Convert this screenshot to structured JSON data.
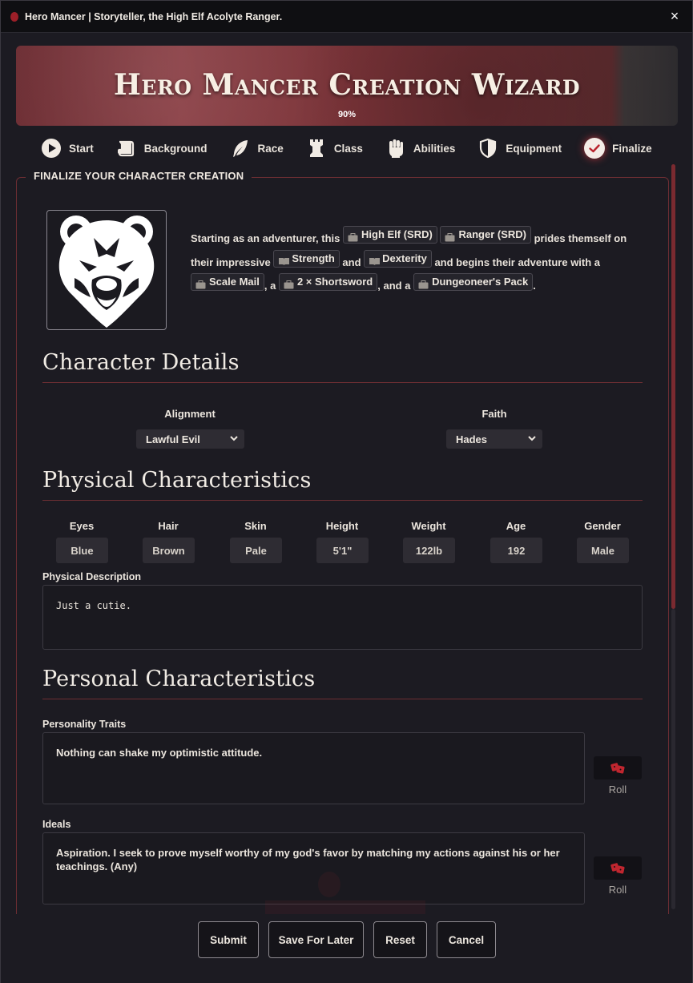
{
  "window": {
    "title": "Hero Mancer | Storyteller, the High Elf Acolyte Ranger.",
    "close_icon": "×"
  },
  "banner": {
    "title": "Hero Mancer Creation Wizard",
    "progress_label": "90%",
    "progress": 0.9
  },
  "steps": [
    {
      "label": "Start",
      "icon": "play-icon"
    },
    {
      "label": "Background",
      "icon": "scroll-icon"
    },
    {
      "label": "Race",
      "icon": "feather-icon"
    },
    {
      "label": "Class",
      "icon": "chess-rook-icon"
    },
    {
      "label": "Abilities",
      "icon": "fist-icon"
    },
    {
      "label": "Equipment",
      "icon": "shield-icon"
    },
    {
      "label": "Finalize",
      "icon": "check-icon",
      "active": true
    }
  ],
  "panel": {
    "legend": "FINALIZE YOUR CHARACTER CREATION"
  },
  "summary": {
    "t1": "Starting as an adventurer, this",
    "race": "High Elf (SRD)",
    "class": "Ranger (SRD)",
    "t2": "prides themself on their impressive",
    "ability1": "Strength",
    "t3": "and",
    "ability2": "Dexterity",
    "t4": "and begins their adventure with a",
    "item1": "Scale Mail",
    "t5": ", a",
    "item2": "2 × Shortsword",
    "t6": ", and a",
    "item3": "Dungeoneer's Pack",
    "t7": "."
  },
  "details": {
    "heading": "Character Details",
    "alignment_label": "Alignment",
    "alignment_value": "Lawful Evil",
    "faith_label": "Faith",
    "faith_value": "Hades"
  },
  "physical": {
    "heading": "Physical Characteristics",
    "fields": [
      {
        "label": "Eyes",
        "value": "Blue"
      },
      {
        "label": "Hair",
        "value": "Brown"
      },
      {
        "label": "Skin",
        "value": "Pale"
      },
      {
        "label": "Height",
        "value": "5'1\""
      },
      {
        "label": "Weight",
        "value": "122lb"
      },
      {
        "label": "Age",
        "value": "192"
      },
      {
        "label": "Gender",
        "value": "Male"
      }
    ],
    "description_label": "Physical Description",
    "description_value": "Just a cutie."
  },
  "personal": {
    "heading": "Personal Characteristics",
    "traits_label": "Personality Traits",
    "traits_value": "Nothing can shake my optimistic attitude.",
    "ideals_label": "Ideals",
    "ideals_value": "Aspiration. I seek to prove myself worthy of my god's favor by matching my actions against his or her teachings. (Any)",
    "roll_label": "Roll"
  },
  "footer": {
    "submit": "Submit",
    "save": "Save For Later",
    "reset": "Reset",
    "cancel": "Cancel"
  },
  "colors": {
    "accent": "#9c1f28",
    "rule": "#6d2e33",
    "dice": "#c0262f"
  }
}
